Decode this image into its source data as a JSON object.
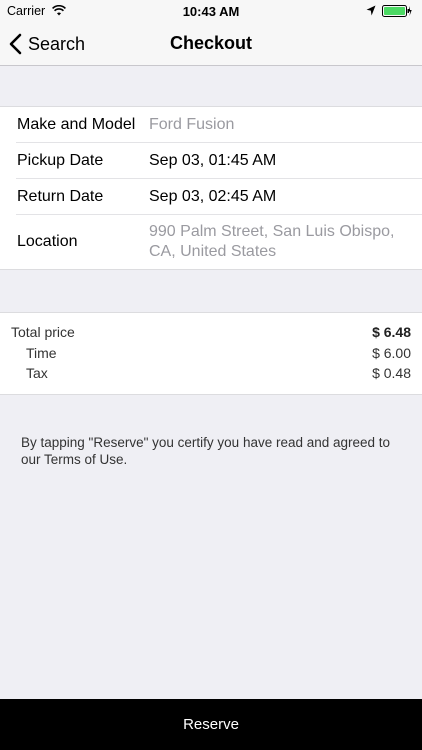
{
  "status_bar": {
    "carrier": "Carrier",
    "time": "10:43 AM"
  },
  "nav": {
    "back_label": "Search",
    "title": "Checkout"
  },
  "details": {
    "rows": [
      {
        "label": "Make and Model",
        "value": "Ford Fusion"
      },
      {
        "label": "Pickup Date",
        "value": "Sep 03, 01:45 AM"
      },
      {
        "label": "Return Date",
        "value": "Sep 03, 02:45 AM"
      },
      {
        "label": "Location",
        "value": "990 Palm Street, San Luis Obispo, CA, United States"
      }
    ]
  },
  "prices": {
    "total_label": "Total price",
    "total_value": "$ 6.48",
    "time_label": "Time",
    "time_value": "$ 6.00",
    "tax_label": "Tax",
    "tax_value": "$ 0.48"
  },
  "terms_text": "By tapping \"Reserve\" you certify you have read and agreed to our Terms of Use.",
  "reserve_label": "Reserve",
  "colors": {
    "muted_text": "#9a9aa0",
    "background": "#efeff4",
    "button_bg": "#000000"
  }
}
